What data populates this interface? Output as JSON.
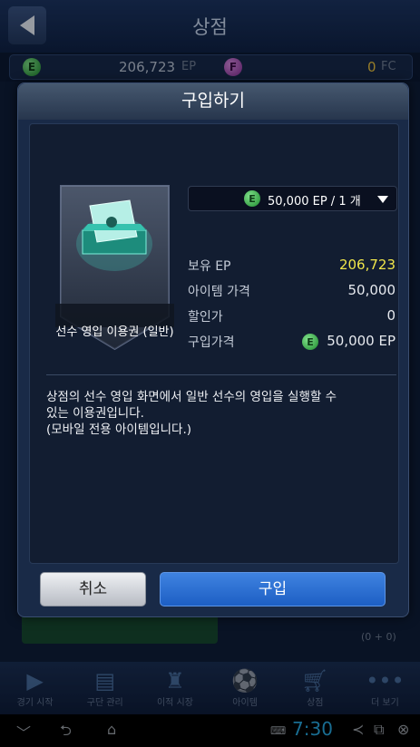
{
  "shop": {
    "title": "상점",
    "ep_amount": "206,723",
    "ep_unit": "EP",
    "fc_amount": "0",
    "fc_unit": "FC",
    "ep_icon_letter": "E",
    "fc_icon_letter": "F"
  },
  "modal": {
    "title": "구입하기",
    "item_name": "선수 영입 이용권 (일반)",
    "quantity_option": "50,000 EP / 1 개",
    "currency_letter": "E",
    "rows": [
      {
        "label": "보유 EP",
        "value": "206,723",
        "color": "#f0e64a"
      },
      {
        "label": "아이템 가격",
        "value": "50,000"
      },
      {
        "label": "할인가",
        "value": "0"
      },
      {
        "label": "구입가격",
        "value": "50,000 EP"
      }
    ],
    "description": "상점의 선수 영입 화면에서 일반 선수의 영입을 실행할 수\n있는 이용권입니다.\n(모바일 전용 아이템입니다.)",
    "cancel_label": "취소",
    "buy_label": "구입"
  },
  "nav": {
    "items": [
      {
        "label": "경기 시작",
        "icon": "play-icon"
      },
      {
        "label": "구단 관리",
        "icon": "clipboard-icon"
      },
      {
        "label": "이적 시장",
        "icon": "jersey-icon"
      },
      {
        "label": "아이템",
        "icon": "ball-icon"
      },
      {
        "label": "상점",
        "icon": "cart-icon"
      },
      {
        "label": "더 보기",
        "icon": "more-icon"
      }
    ]
  },
  "background": {
    "sub_text": "(0 + 0)"
  },
  "system": {
    "time": "7:30"
  },
  "colors": {
    "accent": "#1d5fc4",
    "ep_highlight": "#f0e64a",
    "system_time": "#27a8e0"
  }
}
